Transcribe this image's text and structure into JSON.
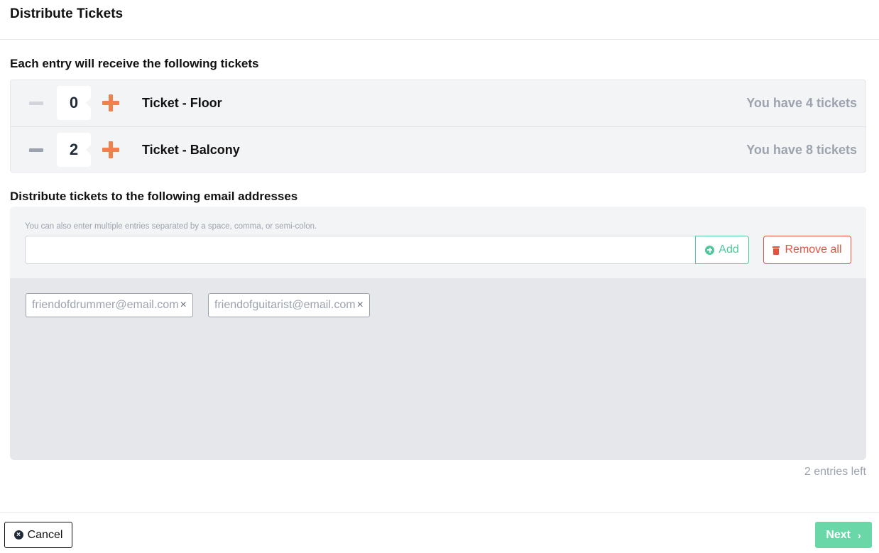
{
  "header": {
    "title": "Distribute Tickets"
  },
  "tickets_section": {
    "title": "Each entry will receive the following tickets",
    "tickets": [
      {
        "name": "Ticket - Floor",
        "quantity": "0",
        "available": "You have 4 tickets",
        "decrement_enabled": false
      },
      {
        "name": "Ticket - Balcony",
        "quantity": "2",
        "available": "You have 8 tickets",
        "decrement_enabled": true
      }
    ]
  },
  "email_section": {
    "title": "Distribute tickets to the following email addresses",
    "hint": "You can also enter multiple entries separated by a space, comma, or semi-colon.",
    "input_value": "",
    "input_placeholder": "",
    "add_label": "Add",
    "remove_all_label": "Remove all",
    "emails": [
      "friendofdrummer@email.com",
      "friendofguitarist@email.com"
    ],
    "chip_close_glyph": "×",
    "entries_left": "2 entries left"
  },
  "footer": {
    "cancel_label": "Cancel",
    "next_label": "Next"
  },
  "colors": {
    "accent_green": "#4fc99a",
    "next_green": "#6ad7a8",
    "danger_red": "#e5533f",
    "plus_orange": "#f0814f"
  },
  "icons": {
    "add": "plus-circle-icon",
    "remove_all": "trash-icon",
    "cancel": "x-circle-icon",
    "next": "chevron-right-icon"
  }
}
